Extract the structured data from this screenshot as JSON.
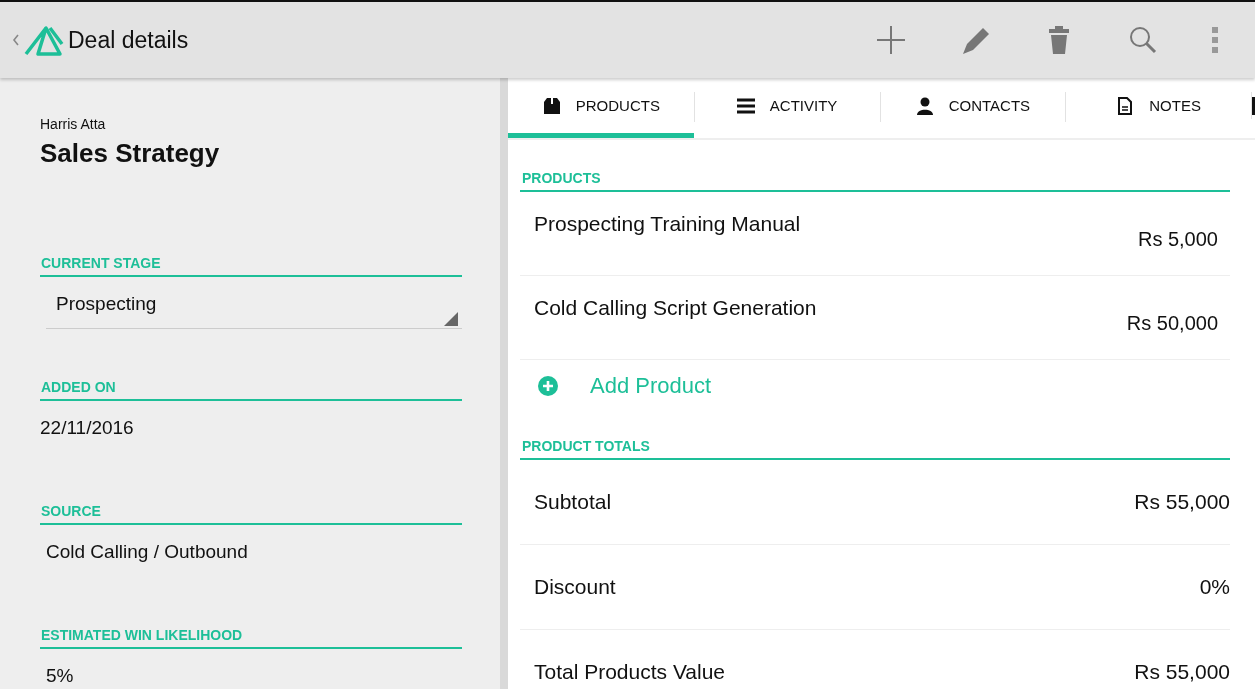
{
  "app_bar": {
    "title": "Deal details"
  },
  "deal": {
    "owner": "Harris Atta",
    "name": "Sales Strategy",
    "fields": [
      {
        "label": "CURRENT STAGE",
        "value": "Prospecting",
        "kind": "dropdown"
      },
      {
        "label": "ADDED ON",
        "value": "22/11/2016",
        "kind": "text"
      },
      {
        "label": "SOURCE",
        "value": "Cold Calling / Outbound",
        "kind": "text"
      },
      {
        "label": "ESTIMATED WIN LIKELIHOOD",
        "value": "5%",
        "kind": "text"
      }
    ]
  },
  "tabs": [
    {
      "label": "PRODUCTS",
      "selected": true
    },
    {
      "label": "ACTIVITY",
      "selected": false
    },
    {
      "label": "CONTACTS",
      "selected": false
    },
    {
      "label": "NOTES",
      "selected": false
    }
  ],
  "products": {
    "heading": "PRODUCTS",
    "items": [
      {
        "name": "Prospecting Training Manual",
        "price": "Rs 5,000"
      },
      {
        "name": "Cold Calling Script Generation",
        "price": "Rs 50,000"
      }
    ],
    "add_label": "Add Product"
  },
  "totals": {
    "heading": "PRODUCT TOTALS",
    "rows": [
      {
        "label": "Subtotal",
        "value": "Rs 55,000"
      },
      {
        "label": "Discount",
        "value": "0%"
      },
      {
        "label": "Total Products Value",
        "value": "Rs 55,000"
      }
    ]
  }
}
